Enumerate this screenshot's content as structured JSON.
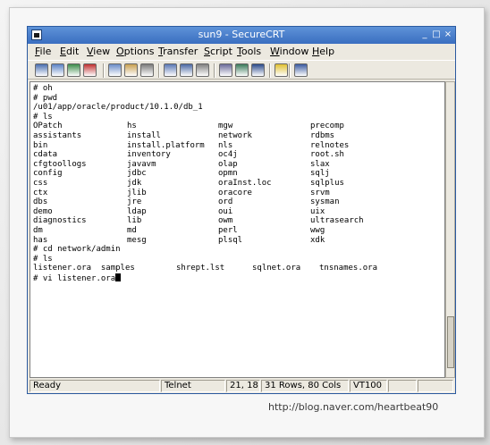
{
  "window": {
    "title": "sun9 - SecureCRT",
    "minimize": "_",
    "maximize": "□",
    "close": "×"
  },
  "menubar": [
    {
      "label": "File",
      "underline": "F",
      "rest": "ile"
    },
    {
      "label": "Edit",
      "underline": "E",
      "rest": "dit"
    },
    {
      "label": "View",
      "underline": "V",
      "rest": "iew"
    },
    {
      "label": "Options",
      "underline": "O",
      "rest": "ptions"
    },
    {
      "label": "Transfer",
      "underline": "T",
      "rest": "ransfer"
    },
    {
      "label": "Script",
      "underline": "S",
      "rest": "cript"
    },
    {
      "label": "Tools",
      "underline": "T",
      "rest": "ools"
    },
    {
      "label": "Window",
      "underline": "W",
      "rest": "indow"
    },
    {
      "label": "Help",
      "underline": "H",
      "rest": "elp"
    }
  ],
  "toolbar": {
    "buttons": [
      {
        "name": "connect-icon",
        "color": "#4a6fb0"
      },
      {
        "name": "quick-connect-icon",
        "color": "#5a82c4"
      },
      {
        "name": "reconnect-icon",
        "color": "#3c8c4a"
      },
      {
        "name": "disconnect-icon",
        "color": "#c03030"
      },
      {
        "name": "copy-icon",
        "color": "#6a8cc8"
      },
      {
        "name": "paste-icon",
        "color": "#c8a050"
      },
      {
        "name": "find-icon",
        "color": "#7a7a7a"
      },
      {
        "name": "print-setup-icon",
        "color": "#5a78b4"
      },
      {
        "name": "print-selection-icon",
        "color": "#4a68a4"
      },
      {
        "name": "print-icon",
        "color": "#808080"
      },
      {
        "name": "session-options-icon",
        "color": "#6a6a9a"
      },
      {
        "name": "global-options-icon",
        "color": "#3a7a5a"
      },
      {
        "name": "keymap-icon",
        "color": "#2a4a8a"
      },
      {
        "name": "help-icon",
        "color": "#e0c030"
      },
      {
        "name": "about-icon",
        "color": "#3a5aa0"
      }
    ]
  },
  "terminal": {
    "lines": [
      [
        "# oh"
      ],
      [
        "# pwd"
      ],
      [
        "/u01/app/oracle/product/10.1.0/db_1"
      ],
      [
        "# ls"
      ],
      [
        "OPatch",
        "hs",
        "mgw",
        "precomp"
      ],
      [
        "assistants",
        "install",
        "network",
        "rdbms"
      ],
      [
        "bin",
        "install.platform",
        "nls",
        "relnotes"
      ],
      [
        "cdata",
        "inventory",
        "oc4j",
        "root.sh"
      ],
      [
        "cfgtoollogs",
        "javavm",
        "olap",
        "slax"
      ],
      [
        "config",
        "jdbc",
        "opmn",
        "sqlj"
      ],
      [
        "css",
        "jdk",
        "oraInst.loc",
        "sqlplus"
      ],
      [
        "ctx",
        "jlib",
        "oracore",
        "srvm"
      ],
      [
        "dbs",
        "jre",
        "ord",
        "sysman"
      ],
      [
        "demo",
        "ldap",
        "oui",
        "uix"
      ],
      [
        "diagnostics",
        "lib",
        "owm",
        "ultrasearch"
      ],
      [
        "dm",
        "md",
        "perl",
        "wwg"
      ],
      [
        "has",
        "mesg",
        "plsql",
        "xdk"
      ],
      [
        "# cd network/admin"
      ],
      [
        "# ls"
      ],
      [
        "listener.ora  samples",
        "shrept.lst",
        "sqlnet.ora",
        "tnsnames.ora"
      ],
      [
        "# vi listener.ora"
      ]
    ]
  },
  "status": {
    "ready": "Ready",
    "protocol": "Telnet",
    "cursor_pos": "21,  18",
    "dimensions": "31 Rows,  80 Cols",
    "emulation": "VT100"
  },
  "watermark": "http://blog.naver.com/heartbeat90"
}
